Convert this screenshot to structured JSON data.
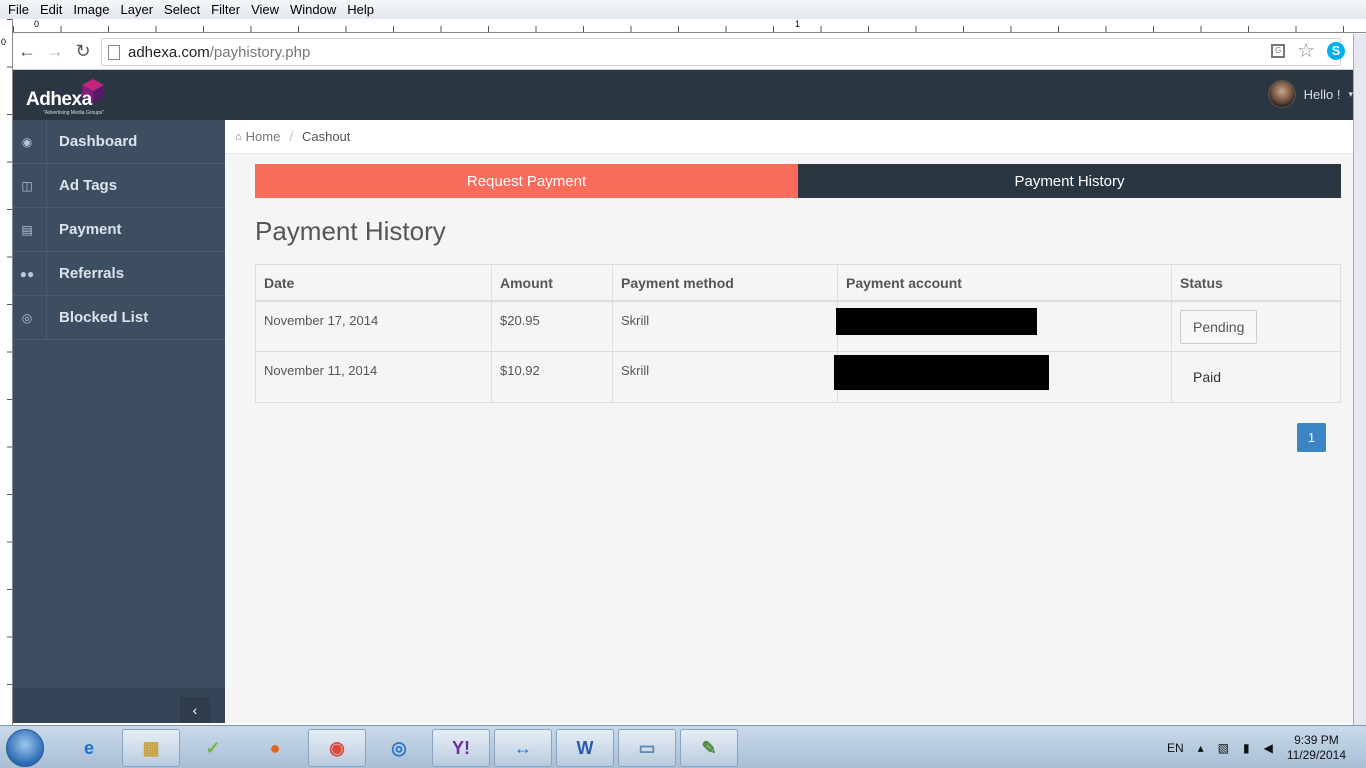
{
  "app_menu": [
    "File",
    "Edit",
    "Image",
    "Layer",
    "Select",
    "Filter",
    "View",
    "Window",
    "Help"
  ],
  "ruler": {
    "left_zero": "0",
    "mark_one": "1",
    "vert_zero": "0"
  },
  "browser": {
    "url_host": "adhexa.com",
    "url_path": "/payhistory.php",
    "back_icon": "back-arrow-icon",
    "forward_icon": "forward-arrow-icon",
    "reload_icon": "reload-icon"
  },
  "header": {
    "logo_text": "Adhexa",
    "logo_tagline": "\"Advertising Media Groups\"",
    "greeting": "Hello !",
    "accent": "#2b3643"
  },
  "sidebar": {
    "items": [
      {
        "label": "Dashboard",
        "icon": "dashboard-icon"
      },
      {
        "label": "Ad Tags",
        "icon": "columns-icon"
      },
      {
        "label": "Payment",
        "icon": "credit-card-icon"
      },
      {
        "label": "Referrals",
        "icon": "users-icon"
      },
      {
        "label": "Blocked List",
        "icon": "eye-slash-icon"
      }
    ],
    "collapse_label": "‹"
  },
  "breadcrumb": {
    "home": "Home",
    "separator": "/",
    "current": "Cashout"
  },
  "tabs": {
    "request": "Request Payment",
    "history": "Payment History",
    "request_color": "#f96b5b",
    "history_color": "#2b3643"
  },
  "page_title": "Payment History",
  "table": {
    "headers": [
      "Date",
      "Amount",
      "Payment method",
      "Payment account",
      "Status"
    ],
    "rows": [
      {
        "date": "November 17, 2014",
        "amount": "$20.95",
        "method": "Skrill",
        "status": "Pending"
      },
      {
        "date": "November 11, 2014",
        "amount": "$10.92",
        "method": "Skrill",
        "status": "Paid"
      }
    ]
  },
  "pagination": {
    "current": "1"
  },
  "taskbar": {
    "lang": "EN",
    "time": "9:39 PM",
    "date": "11/29/2014"
  }
}
